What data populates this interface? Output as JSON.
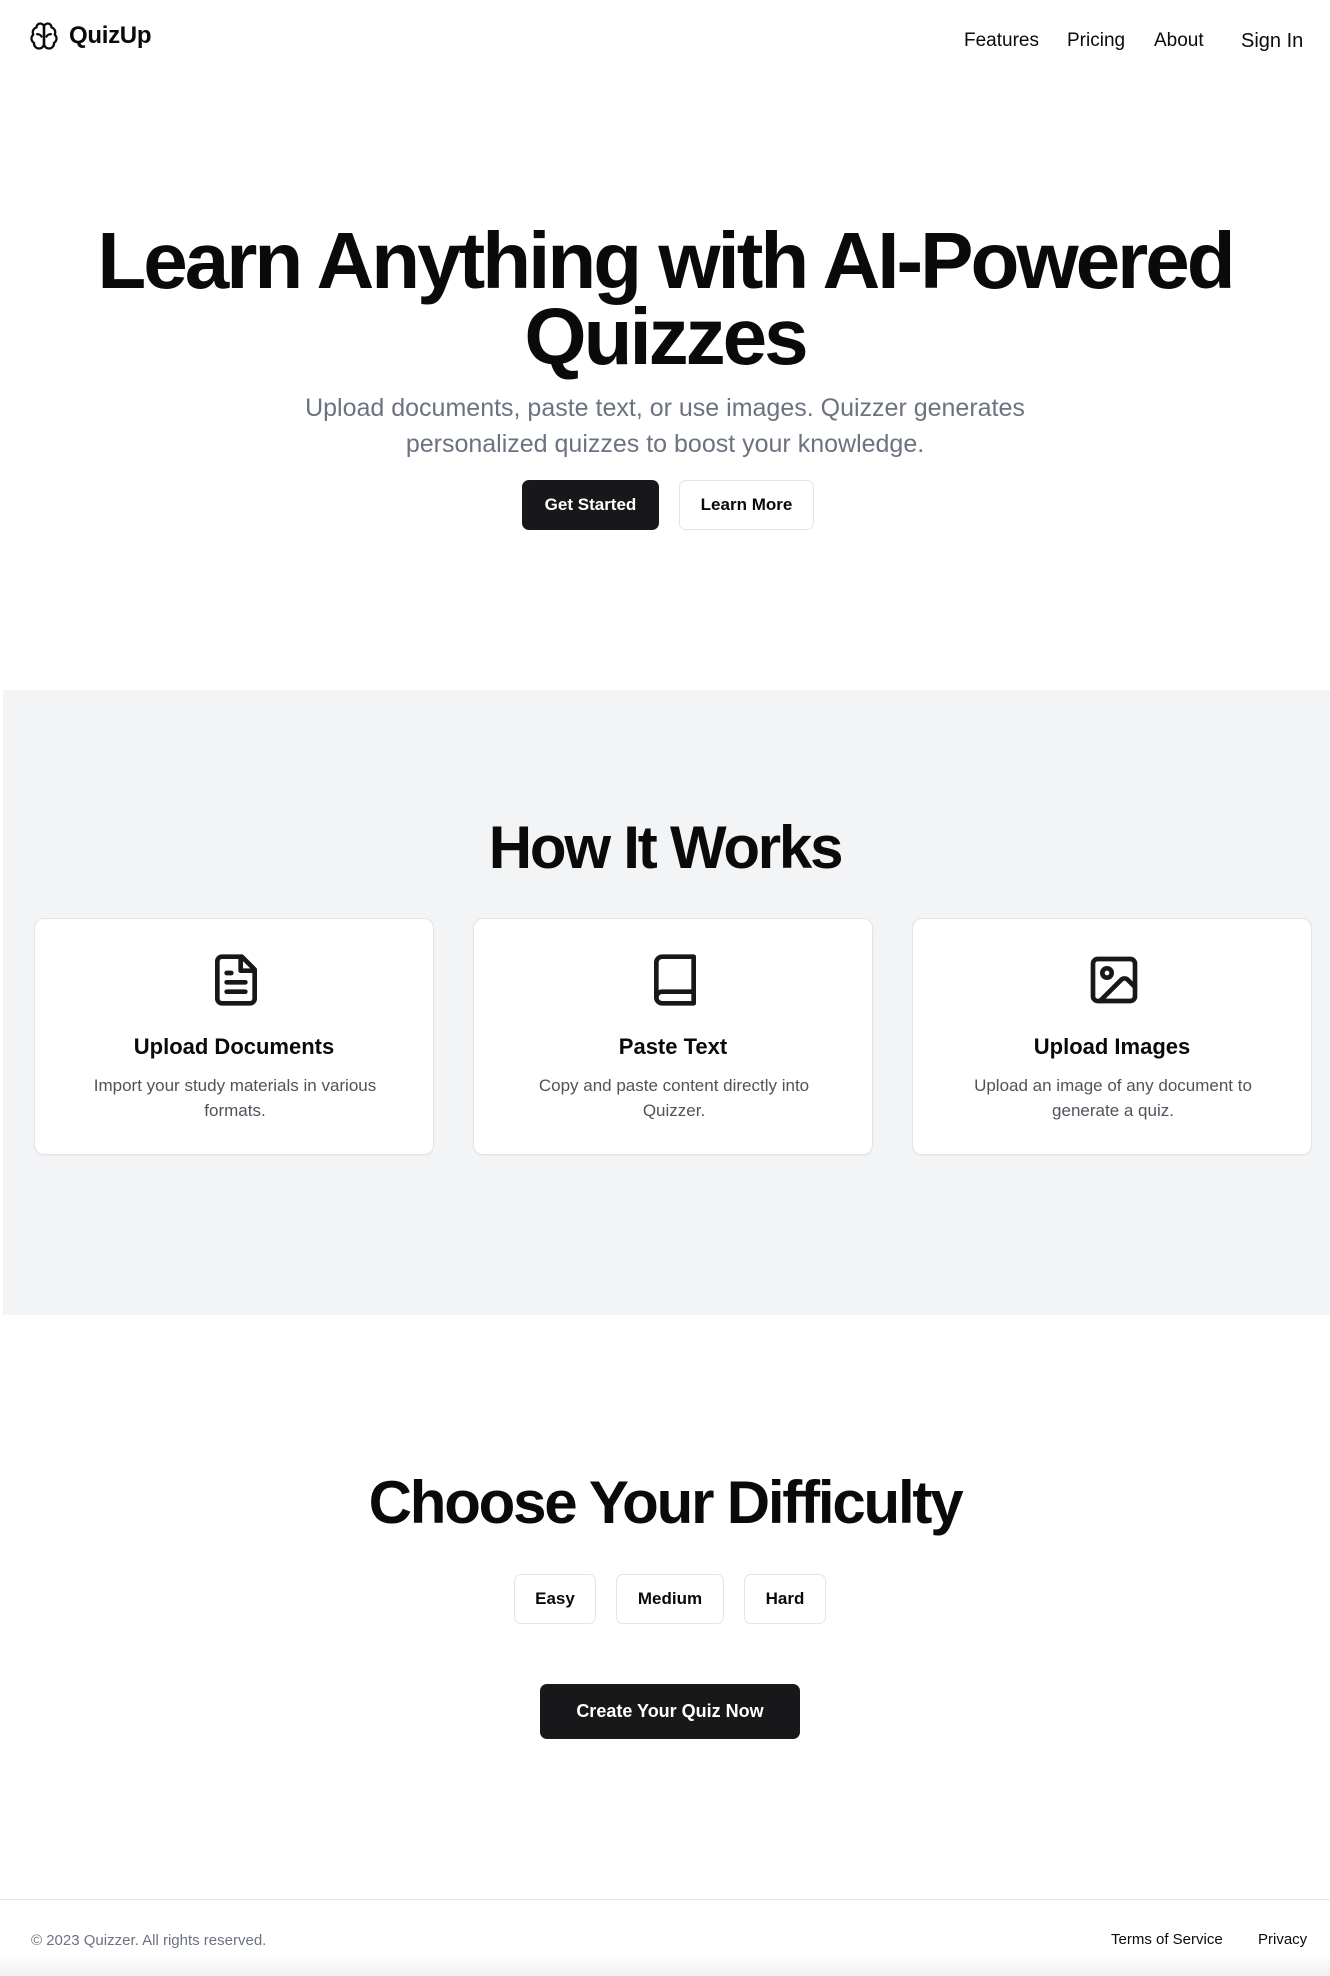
{
  "header": {
    "logo_text": "QuizUp",
    "nav": {
      "features": "Features",
      "pricing": "Pricing",
      "about": "About",
      "sign_in": "Sign In"
    }
  },
  "hero": {
    "title_line1": "Learn Anything with AI-Powered",
    "title_line2": "Quizzes",
    "subtitle": "Upload documents, paste text, or use images. Quizzer generates personalized quizzes to boost your knowledge.",
    "primary_button": "Get Started",
    "secondary_button": "Learn More"
  },
  "how_it_works": {
    "title": "How It Works",
    "cards": [
      {
        "icon": "document-icon",
        "title": "Upload Documents",
        "description": "Import your study materials in various formats."
      },
      {
        "icon": "book-icon",
        "title": "Paste Text",
        "description": "Copy and paste content directly into Quizzer."
      },
      {
        "icon": "image-icon",
        "title": "Upload Images",
        "description": "Upload an image of any document to generate a quiz."
      }
    ]
  },
  "difficulty": {
    "title": "Choose Your Difficulty",
    "options": [
      "Easy",
      "Medium",
      "Hard"
    ],
    "cta": "Create Your Quiz Now"
  },
  "footer": {
    "copyright": "© 2023 Quizzer. All rights reserved.",
    "links": {
      "terms": "Terms of Service",
      "privacy": "Privacy"
    }
  },
  "colors": {
    "primary": "#18181b",
    "muted_text": "#6b7280",
    "section_bg": "#f3f4f6",
    "border": "#e4e4e7"
  }
}
